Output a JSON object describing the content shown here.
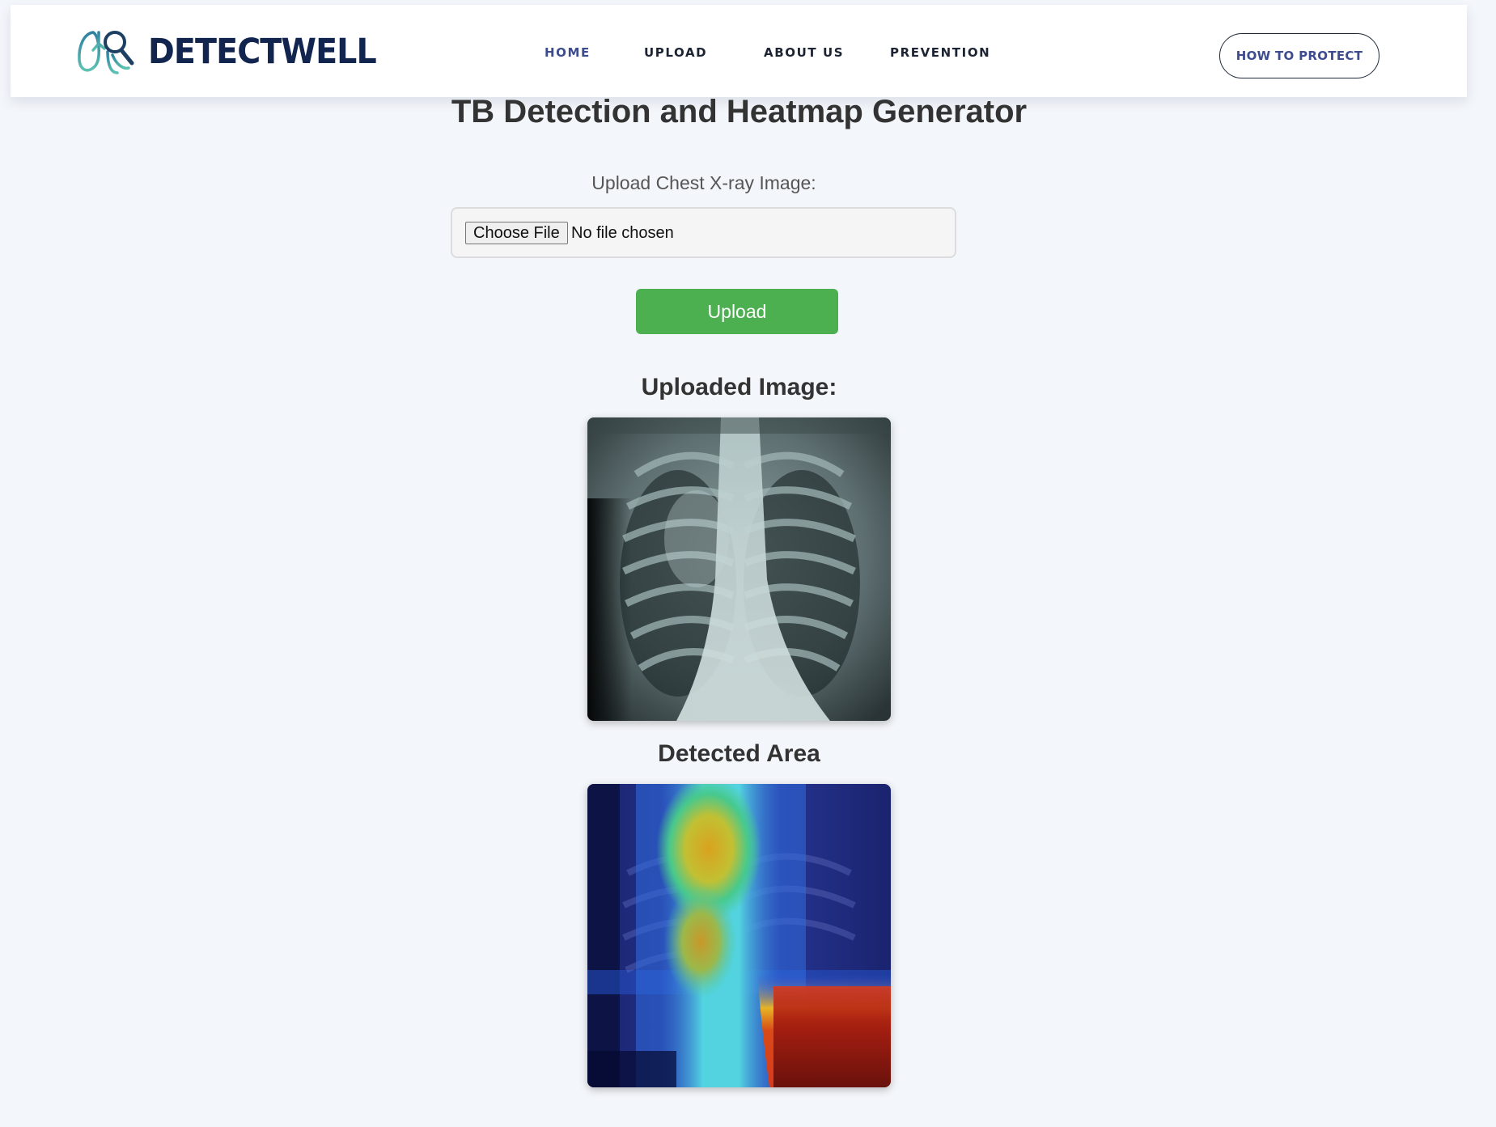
{
  "header": {
    "logo_text": "DETECTWELL",
    "nav": [
      {
        "label": "HOME",
        "active": true
      },
      {
        "label": "UPLOAD",
        "active": false
      },
      {
        "label": "ABOUT US",
        "active": false
      },
      {
        "label": "PREVENTION",
        "active": false
      }
    ],
    "cta_label": "HOW TO PROTECT"
  },
  "main": {
    "title": "TB Detection and Heatmap Generator",
    "upload_label": "Upload Chest X-ray Image:",
    "file_input": {
      "button_label": "Choose File",
      "status": "No file chosen"
    },
    "upload_button": "Upload",
    "uploaded_heading": "Uploaded Image:",
    "detected_heading": "Detected Area"
  },
  "colors": {
    "brand_navy": "#12254e",
    "nav_active": "#3d4c8e",
    "upload_green": "#4caf50",
    "page_bg": "#f3f6fa"
  }
}
